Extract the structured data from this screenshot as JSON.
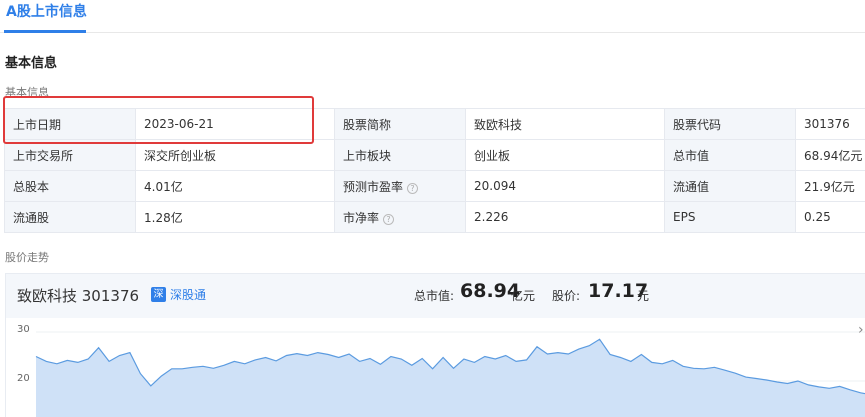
{
  "tabs": {
    "active": "A股上市信息"
  },
  "section": {
    "title": "基本信息",
    "subtitle": "基本信息",
    "trend_title": "股价走势"
  },
  "info_table": [
    [
      {
        "label": "上市日期",
        "value": "2023-06-21"
      },
      {
        "label": "股票简称",
        "value": "致欧科技"
      },
      {
        "label": "股票代码",
        "value": "301376"
      }
    ],
    [
      {
        "label": "上市交易所",
        "value": "深交所创业板"
      },
      {
        "label": "上市板块",
        "value": "创业板"
      },
      {
        "label": "总市值",
        "value": "68.94亿元"
      }
    ],
    [
      {
        "label": "总股本",
        "value": "4.01亿"
      },
      {
        "label": "预测市盈率",
        "value": "20.094",
        "help": true
      },
      {
        "label": "流通值",
        "value": "21.9亿元"
      }
    ],
    [
      {
        "label": "流通股",
        "value": "1.28亿"
      },
      {
        "label": "市净率",
        "value": "2.226",
        "help": true
      },
      {
        "label": "EPS",
        "value": "0.25"
      }
    ]
  ],
  "chart_panel": {
    "stock_name": "致欧科技 301376",
    "connect_badge": "深",
    "connect_label": "深股通",
    "market_cap_label": "总市值:",
    "market_cap_value": "68.94",
    "market_cap_unit": "亿元",
    "price_label": "股价:",
    "price_value": "17.17",
    "price_unit": "元"
  },
  "colors": {
    "accent": "#2f7fe8",
    "highlight": "#e03a3a",
    "line": "#5b9be0",
    "area": "#cfe1f7"
  },
  "chart_data": {
    "type": "area",
    "ylim": [
      0,
      32
    ],
    "y_ticks": [
      "30",
      "20"
    ],
    "values": [
      25.0,
      24.0,
      23.5,
      24.2,
      23.8,
      24.5,
      26.8,
      24.0,
      25.2,
      25.8,
      21.5,
      19.0,
      21.0,
      22.5,
      22.5,
      22.8,
      23.0,
      22.6,
      23.2,
      24.0,
      23.5,
      24.3,
      24.8,
      24.1,
      25.2,
      25.6,
      25.2,
      25.8,
      25.4,
      24.8,
      25.5,
      24.0,
      24.6,
      23.4,
      25.0,
      24.5,
      23.2,
      24.6,
      22.5,
      24.8,
      22.6,
      24.5,
      23.8,
      25.0,
      24.5,
      25.2,
      24.0,
      24.3,
      27.0,
      25.5,
      25.8,
      25.5,
      26.5,
      27.2,
      28.5,
      25.4,
      24.8,
      24.0,
      25.4,
      23.8,
      23.5,
      24.2,
      23.0,
      22.6,
      22.5,
      22.8,
      22.2,
      21.6,
      20.8,
      20.5,
      20.2,
      19.8,
      19.5,
      20.0,
      19.2,
      18.8,
      18.5,
      18.9,
      18.2,
      17.6,
      17.2
    ]
  }
}
